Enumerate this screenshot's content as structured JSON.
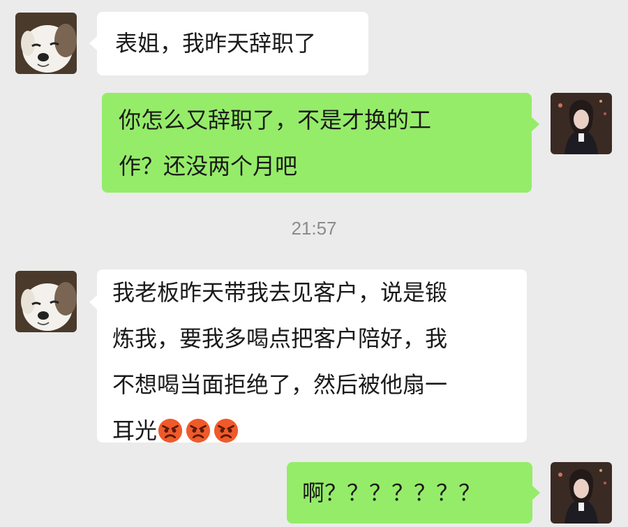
{
  "messages": [
    {
      "sender": "contact",
      "text": "表姐，我昨天辞职了"
    },
    {
      "sender": "me",
      "text": "你怎么又辞职了，不是才换的工\n作？还没两个月吧"
    },
    {
      "sender": "contact",
      "text": "我老板昨天带我去见客户，说是锻\n炼我，要我多喝点把客户陪好，我\n不想喝当面拒绝了，然后被他扇一\n耳光",
      "emojis": [
        "angry-face-icon",
        "angry-face-icon",
        "angry-face-icon"
      ]
    },
    {
      "sender": "me",
      "text": "啊？？？？？？？"
    }
  ],
  "timestamp": "21:57",
  "colors": {
    "background": "#ebebeb",
    "incoming_bubble": "#ffffff",
    "outgoing_bubble": "#95ec69",
    "timestamp_text": "#8c8c8c"
  }
}
